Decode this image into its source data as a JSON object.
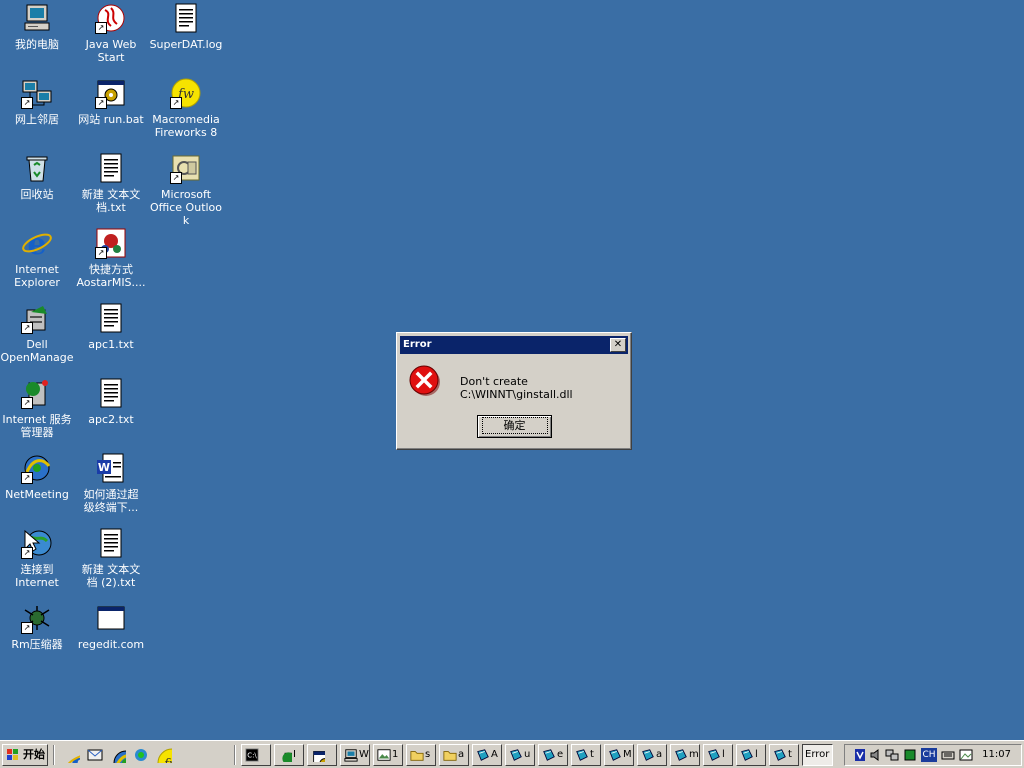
{
  "desktop": {
    "icons": [
      {
        "label": "我的电脑",
        "icon": "my-computer-icon"
      },
      {
        "label": "Java Web\nStart",
        "icon": "java-web-start-icon"
      },
      {
        "label": "SuperDAT.log",
        "icon": "text-file-icon"
      },
      {
        "label": "网上邻居",
        "icon": "network-neighborhood-icon"
      },
      {
        "label": "网站 run.bat",
        "icon": "batch-file-icon"
      },
      {
        "label": "Macromedia\nFireworks 8",
        "icon": "fireworks-icon"
      },
      {
        "label": "回收站",
        "icon": "recycle-bin-icon"
      },
      {
        "label": "新建 文本文\n档.txt",
        "icon": "text-file-icon"
      },
      {
        "label": "Microsoft\nOffice Outlook",
        "icon": "outlook-icon"
      },
      {
        "label": "Internet\nExplorer",
        "icon": "internet-explorer-icon"
      },
      {
        "label": "快捷方式\nAostarMIS....",
        "icon": "aostar-icon"
      },
      {
        "label": "Dell\nOpenManage",
        "icon": "dell-openmanage-icon"
      },
      {
        "label": "apc1.txt",
        "icon": "text-file-icon"
      },
      {
        "label": "Internet 服务\n管理器",
        "icon": "iis-manager-icon"
      },
      {
        "label": "apc2.txt",
        "icon": "text-file-icon"
      },
      {
        "label": "NetMeeting",
        "icon": "netmeeting-icon"
      },
      {
        "label": "如何通过超\n级终端下...",
        "icon": "word-document-icon"
      },
      {
        "label": "连接到\nInternet",
        "icon": "connect-internet-icon"
      },
      {
        "label": "新建 文本文\n档 (2).txt",
        "icon": "text-file-icon"
      },
      {
        "label": "Rm压缩器",
        "icon": "rm-compressor-icon"
      },
      {
        "label": "regedit.com",
        "icon": "window-app-icon"
      }
    ]
  },
  "dialog": {
    "title": "Error",
    "close_glyph": "✕",
    "icon": "error-icon",
    "message": "Don't create C:\\WINNT\\ginstall.dll",
    "ok_label": "确定"
  },
  "taskbar": {
    "start_label": "开始",
    "quick_launch": [
      "internet-explorer-icon",
      "outlook-express-icon",
      "netmeeting-icon",
      "msn-icon",
      "fireworks-icon"
    ],
    "tasks": [
      {
        "label": "",
        "icon": "command-prompt-icon"
      },
      {
        "label": "I",
        "icon": "iis-manager-icon"
      },
      {
        "label": "",
        "icon": "batch-file-icon"
      },
      {
        "label": "W",
        "icon": "computer-icon"
      },
      {
        "label": "1",
        "icon": "image-icon"
      },
      {
        "label": "s",
        "icon": "folder-icon"
      },
      {
        "label": "a",
        "icon": "folder-icon"
      },
      {
        "label": "A",
        "icon": "notepad-icon"
      },
      {
        "label": "u",
        "icon": "notepad-icon"
      },
      {
        "label": "e",
        "icon": "notepad-icon"
      },
      {
        "label": "t",
        "icon": "notepad-icon"
      },
      {
        "label": "M",
        "icon": "notepad-icon"
      },
      {
        "label": "a",
        "icon": "notepad-icon"
      },
      {
        "label": "m",
        "icon": "notepad-icon"
      },
      {
        "label": "l",
        "icon": "notepad-icon"
      },
      {
        "label": "l",
        "icon": "notepad-icon"
      },
      {
        "label": "t",
        "icon": "notepad-icon"
      }
    ],
    "active_task_label": "Error",
    "tray": {
      "lang": "CH",
      "clock": "11:07"
    }
  }
}
